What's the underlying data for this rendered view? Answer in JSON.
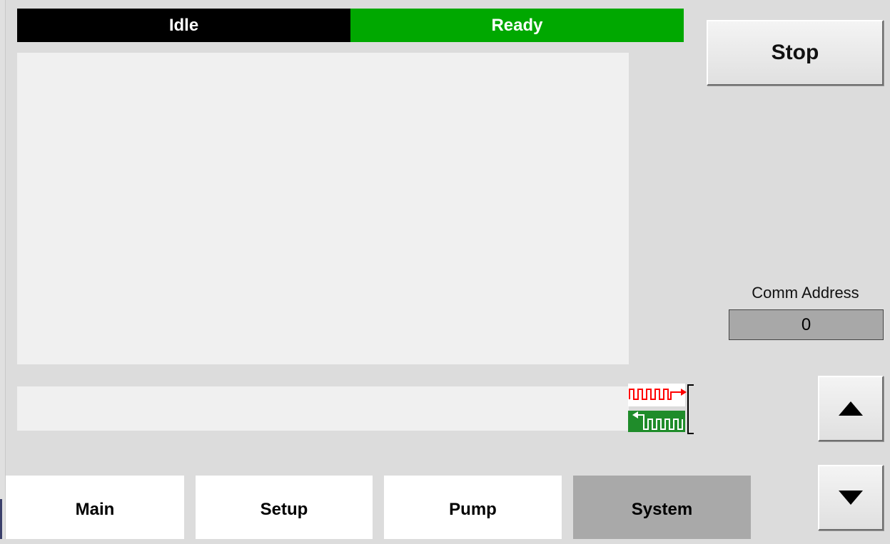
{
  "status": {
    "mode_label": "Idle",
    "state_label": "Ready",
    "mode_color": "#000000",
    "state_color": "#00a800"
  },
  "controls": {
    "stop_label": "Stop"
  },
  "comm": {
    "address_label": "Comm Address",
    "address_value": "0",
    "tx_color": "#ff0000",
    "rx_color": "#008000"
  },
  "icons": {
    "scroll_up": "triangle-up-icon",
    "scroll_down": "triangle-down-icon",
    "comm_activity": "comm-tx-rx-icon"
  },
  "tabs": [
    {
      "label": "Main",
      "active": false
    },
    {
      "label": "Setup",
      "active": false
    },
    {
      "label": "Pump",
      "active": false
    },
    {
      "label": "System",
      "active": true
    }
  ]
}
